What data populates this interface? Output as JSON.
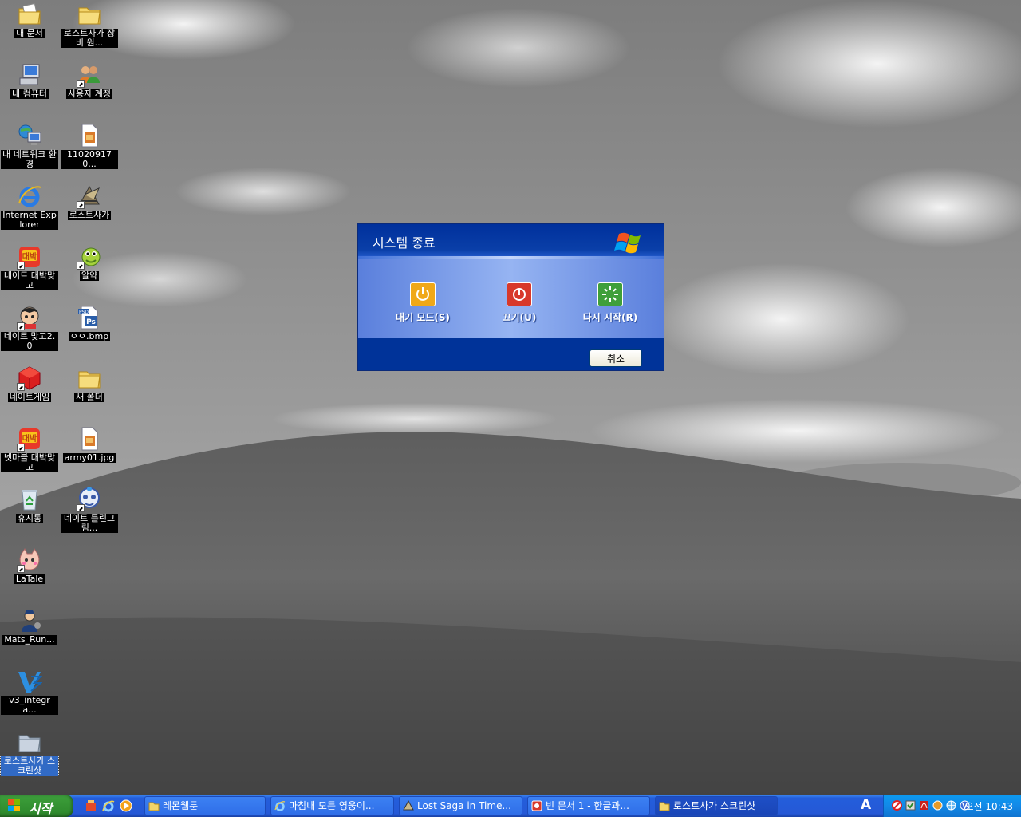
{
  "desktop": {
    "icons": [
      {
        "label": "내 문서"
      },
      {
        "label": "로스트사가 장비 원..."
      },
      {
        "label": "내 컴퓨터"
      },
      {
        "label": "사용자 계정"
      },
      {
        "label": "내 네트워크 환경"
      },
      {
        "label": "110209170..."
      },
      {
        "label": "Internet Explorer"
      },
      {
        "label": "로스트사가"
      },
      {
        "label": "네이트 대박맞고"
      },
      {
        "label": "알약"
      },
      {
        "label": "네이트 맞고2.0"
      },
      {
        "label": "ㅇㅇ.bmp"
      },
      {
        "label": "네이트게임"
      },
      {
        "label": "새 폴더"
      },
      {
        "label": "넷마블 대박맞고"
      },
      {
        "label": "army01.jpg"
      },
      {
        "label": "휴지통"
      },
      {
        "label": "네이트 틀린그림..."
      },
      {
        "label": "LaTale"
      },
      {
        "label": "Mats_Run..."
      },
      {
        "label": "v3_integra..."
      },
      {
        "label": "로스트사가 스크린샷"
      }
    ]
  },
  "dialog": {
    "title": "시스템 종료",
    "actions": [
      {
        "label": "대기 모드(S)",
        "icon": "standby-icon",
        "color": "#f0a818"
      },
      {
        "label": "끄기(U)",
        "icon": "power-off-icon",
        "color": "#d8392b"
      },
      {
        "label": "다시 시작(R)",
        "icon": "restart-icon",
        "color": "#3f9f3a"
      }
    ],
    "cancel_label": "취소"
  },
  "taskbar": {
    "start_label": "시작",
    "windows": [
      {
        "label": "레몬웹툰",
        "icon": "folder-icon"
      },
      {
        "label": "마침내 모든 영웅이...",
        "icon": "ie-icon"
      },
      {
        "label": "Lost Saga in Time...",
        "icon": "lostsaga-icon"
      },
      {
        "label": "빈 문서 1 - 한글과...",
        "icon": "hwp-icon"
      },
      {
        "label": "로스트사가 스크린샷",
        "icon": "folder-icon"
      }
    ],
    "language": "A",
    "clock": "오전 10:43"
  }
}
